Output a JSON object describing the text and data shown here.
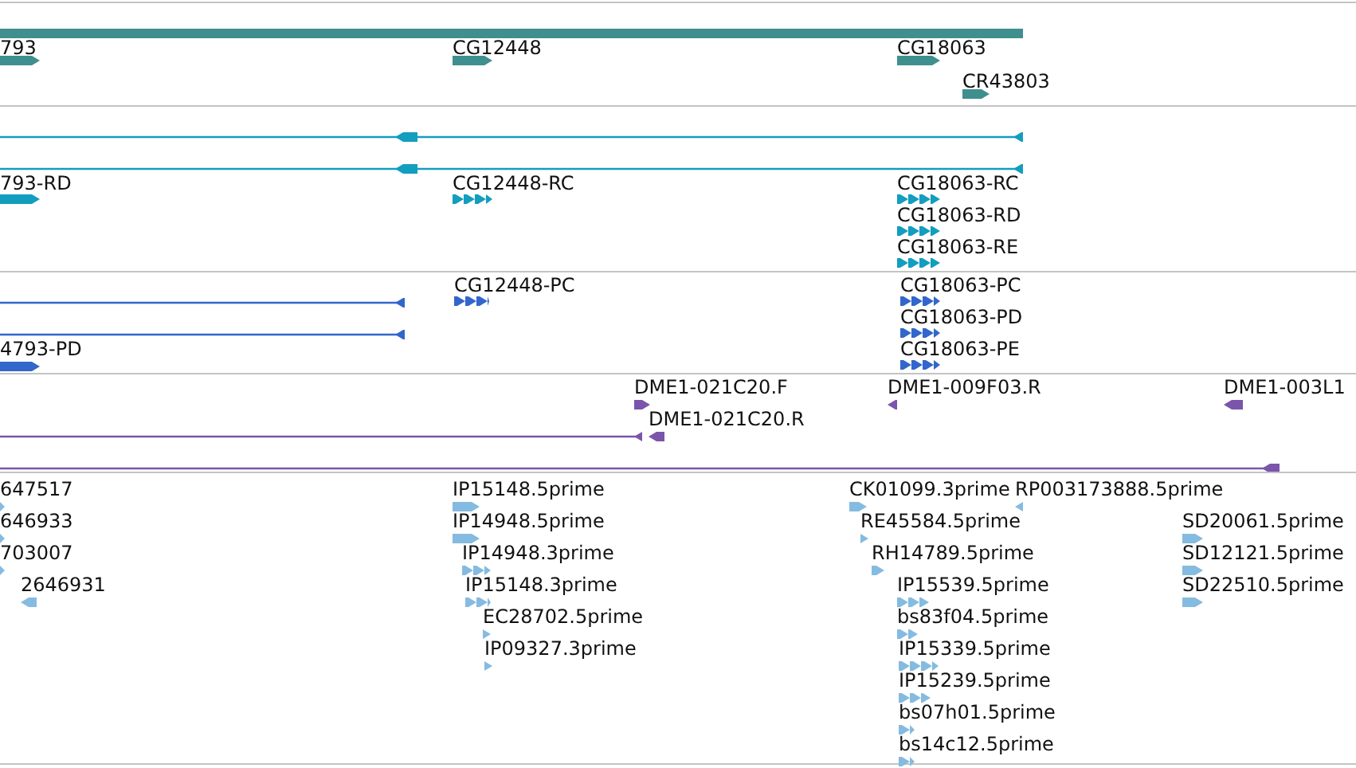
{
  "tracks": [
    {
      "color": "#3f8f8f",
      "features": [
        {
          "kind": "span"
        },
        {
          "kind": "block",
          "label": "793",
          "reverse": false
        },
        {
          "kind": "block",
          "label": "CG12448",
          "reverse": false
        },
        {
          "kind": "block",
          "label": "CG18063",
          "reverse": false
        },
        {
          "kind": "block",
          "label": "CR43803",
          "reverse": false
        }
      ]
    },
    {
      "color": "#139dbf",
      "features": [
        {
          "kind": "line",
          "reverse": true
        },
        {
          "kind": "line",
          "reverse": true
        },
        {
          "kind": "block",
          "label": "793-RD",
          "reverse": false
        },
        {
          "kind": "chevrons",
          "label": "CG12448-RC",
          "reverse": false
        },
        {
          "kind": "chevrons",
          "label": "CG18063-RC",
          "reverse": false
        },
        {
          "kind": "chevrons",
          "label": "CG18063-RD",
          "reverse": false
        },
        {
          "kind": "chevrons",
          "label": "CG18063-RE",
          "reverse": false
        }
      ]
    },
    {
      "color": "#3366cc",
      "features": [
        {
          "kind": "line",
          "reverse": true
        },
        {
          "kind": "line",
          "reverse": true
        },
        {
          "kind": "block",
          "label": "4793-PD",
          "reverse": false
        },
        {
          "kind": "chevrons",
          "label": "CG12448-PC",
          "reverse": false
        },
        {
          "kind": "chevrons",
          "label": "CG18063-PC",
          "reverse": false
        },
        {
          "kind": "chevrons",
          "label": "CG18063-PD",
          "reverse": false
        },
        {
          "kind": "chevrons",
          "label": "CG18063-PE",
          "reverse": false
        }
      ]
    },
    {
      "color": "#7a55ab",
      "features": [
        {
          "kind": "block",
          "label": "DME1-021C20.F",
          "reverse": false
        },
        {
          "kind": "block",
          "label": "DME1-021C20.R",
          "reverse": true
        },
        {
          "kind": "line",
          "reverse": true
        },
        {
          "kind": "block",
          "label": "DME1-009F03.R",
          "reverse": true
        },
        {
          "kind": "block",
          "label": "DME1-003L1",
          "reverse": true
        },
        {
          "kind": "line",
          "reverse": true
        }
      ]
    },
    {
      "color": "#85bbe0",
      "features": [
        {
          "kind": "block",
          "label": "647517",
          "reverse": false
        },
        {
          "kind": "block",
          "label": "646933",
          "reverse": false
        },
        {
          "kind": "block",
          "label": "703007",
          "reverse": false
        },
        {
          "kind": "block",
          "label": "2646931",
          "reverse": true
        },
        {
          "kind": "block",
          "label": "IP15148.5prime",
          "reverse": false
        },
        {
          "kind": "block",
          "label": "IP14948.5prime",
          "reverse": false
        },
        {
          "kind": "chevrons",
          "label": "IP14948.3prime",
          "reverse": false
        },
        {
          "kind": "chevrons",
          "label": "IP15148.3prime",
          "reverse": false
        },
        {
          "kind": "block",
          "label": "EC28702.5prime",
          "reverse": false
        },
        {
          "kind": "block",
          "label": "IP09327.3prime",
          "reverse": false
        },
        {
          "kind": "block",
          "label": "CK01099.3prime",
          "reverse": false
        },
        {
          "kind": "block",
          "label": "RP003173888.5prime",
          "reverse": true
        },
        {
          "kind": "block",
          "label": "RE45584.5prime",
          "reverse": false
        },
        {
          "kind": "block",
          "label": "RH14789.5prime",
          "reverse": false
        },
        {
          "kind": "chevrons",
          "label": "IP15539.5prime",
          "reverse": false
        },
        {
          "kind": "chevrons",
          "label": "bs83f04.5prime",
          "reverse": false
        },
        {
          "kind": "chevrons",
          "label": "IP15339.5prime",
          "reverse": false
        },
        {
          "kind": "chevrons",
          "label": "IP15239.5prime",
          "reverse": false
        },
        {
          "kind": "chevrons",
          "label": "bs07h01.5prime",
          "reverse": false
        },
        {
          "kind": "chevrons",
          "label": "bs14c12.5prime",
          "reverse": false
        },
        {
          "kind": "block",
          "label": "SD20061.5prime",
          "reverse": false
        },
        {
          "kind": "block",
          "label": "SD12121.5prime",
          "reverse": false
        },
        {
          "kind": "block",
          "label": "SD22510.5prime",
          "reverse": false
        }
      ]
    }
  ]
}
